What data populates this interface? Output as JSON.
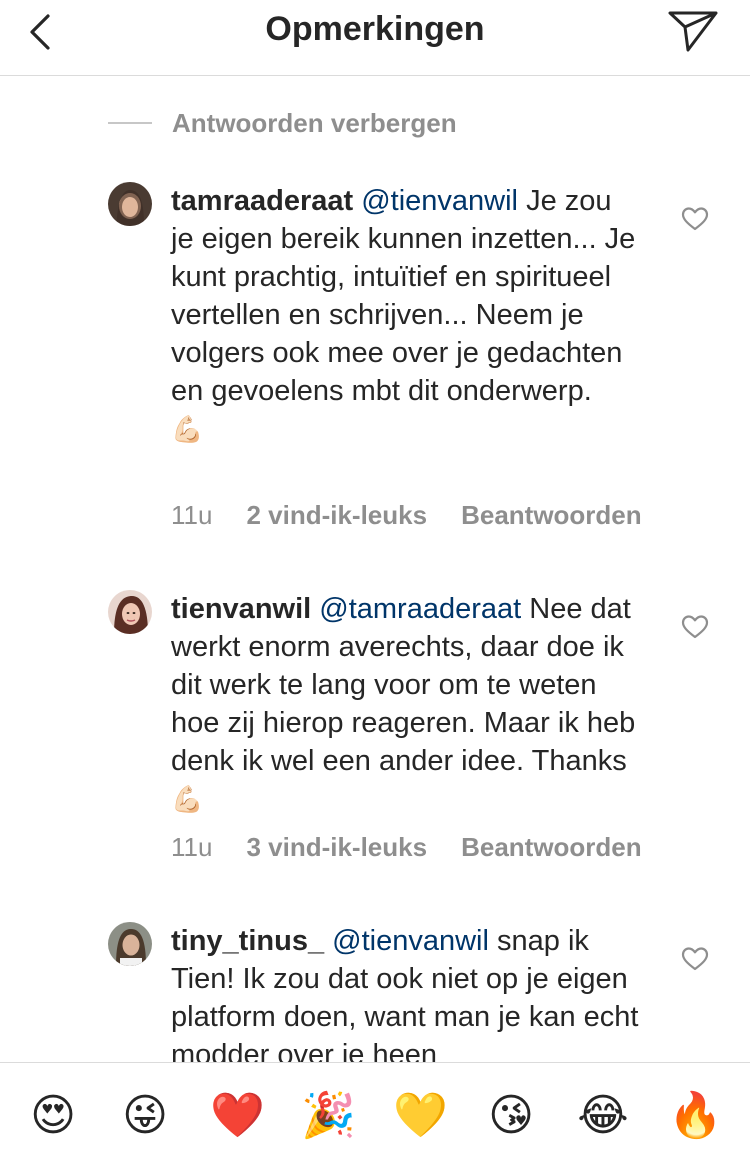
{
  "header": {
    "title": "Opmerkingen"
  },
  "thread": {
    "hide_replies_label": "Antwoorden verbergen"
  },
  "comments": [
    {
      "username": "tamraaderaat",
      "mention": "@tienvanwil",
      "text": "Je zou je eigen bereik kunnen inzetten... Je kunt prachtig, intuïtief en spiritueel vertellen en schrijven... Neem je volgers ook mee over je gedachten en gevoelens mbt dit onderwerp.",
      "emoji": "💪🏻",
      "time": "11u",
      "likes": "2 vind-ik-leuks",
      "reply_label": "Beantwoorden"
    },
    {
      "username": "tienvanwil",
      "mention": "@tamraaderaat",
      "text": "Nee dat werkt enorm averechts, daar doe ik dit werk te lang voor om te weten hoe zij hierop reageren. Maar ik heb denk ik wel een ander idee. Thanks",
      "emoji": "💪🏻",
      "time": "11u",
      "likes": "3 vind-ik-leuks",
      "reply_label": "Beantwoorden"
    },
    {
      "username": "tiny_tinus_",
      "mention": "@tienvanwil",
      "text": "snap ik Tien! Ik zou dat ook niet op je eigen platform doen, want man je kan echt modder over je heen",
      "emoji": ""
    }
  ],
  "emoji_bar": [
    {
      "icon": "heart-eyes-emoji",
      "char": "😍"
    },
    {
      "icon": "winking-tongue-emoji",
      "char": "😜"
    },
    {
      "icon": "red-heart-emoji",
      "char": "❤️"
    },
    {
      "icon": "party-popper-emoji",
      "char": "🎉"
    },
    {
      "icon": "yellow-heart-emoji",
      "char": "💛"
    },
    {
      "icon": "kissing-heart-emoji",
      "char": "😘"
    },
    {
      "icon": "tears-of-joy-emoji",
      "char": "😂"
    },
    {
      "icon": "fire-emoji",
      "char": "🔥"
    }
  ],
  "colors": {
    "text": "#262626",
    "mention": "#003569",
    "secondary": "#8e8e8e",
    "divider": "#dbdbdb"
  }
}
